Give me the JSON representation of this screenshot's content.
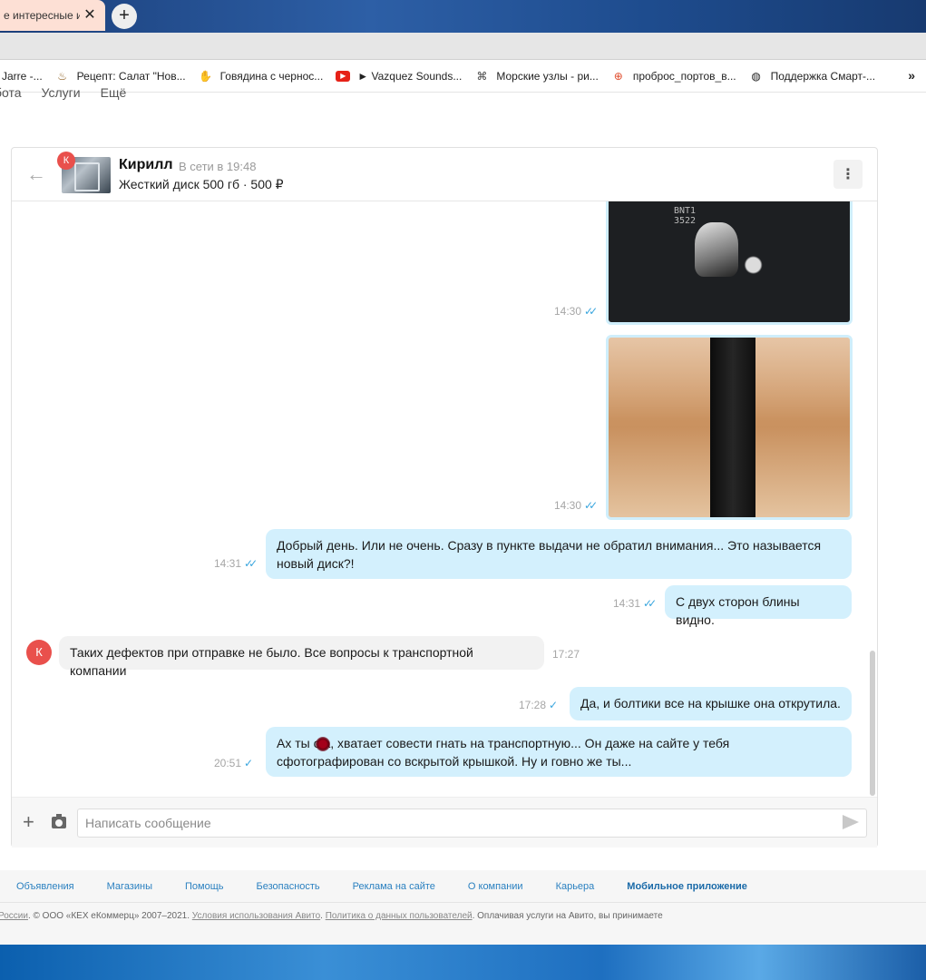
{
  "browser": {
    "tab_title": "е интересные и",
    "tab_close": "✕",
    "new_tab": "+",
    "bookmarks": [
      {
        "label": "l Jarre -...",
        "icon": "jarre-icon"
      },
      {
        "label": "Рецепт: Салат \"Нов...",
        "icon": "recipe-icon"
      },
      {
        "label": "Говядина с чернос...",
        "icon": "hand-icon"
      },
      {
        "label": "► Vazquez Sounds...",
        "icon": "youtube-icon"
      },
      {
        "label": "Морские узлы - ри...",
        "icon": "knot-icon"
      },
      {
        "label": "проброс_портов_в...",
        "icon": "lifebuoy-icon"
      },
      {
        "label": "Поддержка Смарт-...",
        "icon": "globe-icon"
      }
    ],
    "more_bookmarks": "»"
  },
  "page_nav": {
    "items": [
      "бота",
      "Услуги",
      "Ещё"
    ]
  },
  "chat": {
    "contact_initial": "К",
    "contact_name": "Кирилл",
    "contact_status": "В сети в 19:48",
    "item": "Жесткий диск 500 гб · 500 ₽",
    "menu_icon": "⋮",
    "back_icon": "←",
    "messages": [
      {
        "type": "photo",
        "time": "14:30",
        "ticks": "✓✓"
      },
      {
        "type": "photo",
        "time": "14:30",
        "ticks": "✓✓"
      },
      {
        "type": "out",
        "text_line1": "Добрый день. Или не очень. Сразу в пункте выдачи не обратил внимания... Это называется",
        "text_line2": "новый диск?!",
        "time": "14:31",
        "ticks": "✓✓"
      },
      {
        "type": "out",
        "text": "С двух сторон блины видно.",
        "time": "14:31",
        "ticks": "✓✓"
      },
      {
        "type": "in",
        "text": "Таких дефектов при отправке не было. Все вопросы к транспортной компании",
        "time": "17:27"
      },
      {
        "type": "out",
        "text": "Да, и болтики все на крышке она открутила.",
        "time": "17:28",
        "ticks": "✓"
      },
      {
        "type": "out",
        "text_line1": "Ах ты с а, хватает совести гнать на транспортную... Он даже на сайте у тебя",
        "text_line2": "сфотографирован со вскрытой крышкой. Ну и говно же ты...",
        "time": "20:51",
        "ticks": "✓"
      }
    ],
    "photo1_label": "BNT1\n3522",
    "composer": {
      "placeholder": "Написать сообщение",
      "plus": "+"
    }
  },
  "footer": {
    "links": [
      "Объявления",
      "Магазины",
      "Помощь",
      "Безопасность",
      "Реклама на сайте",
      "О компании",
      "Карьера",
      "Мобильное приложение"
    ],
    "legal_prefix": "России",
    "legal_text1": ". © ООО «КЕХ еКоммерц» 2007–2021. ",
    "legal_terms": "Условия использования Авито",
    "legal_sep": ". ",
    "legal_privacy": "Политика о данных пользователей",
    "legal_text2": ". Оплачивая услуги на Авито, вы принимаете"
  },
  "colors": {
    "outgoing_bubble": "#d3f0fd",
    "incoming_bubble": "#f2f2f2",
    "avatar": "#e9504c",
    "tick": "#3aa6de",
    "link": "#2a80c0"
  }
}
